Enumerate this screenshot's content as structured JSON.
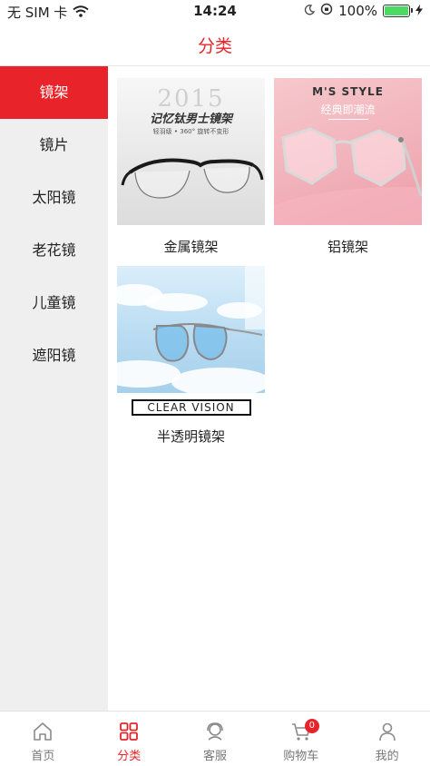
{
  "status_bar": {
    "carrier": "无 SIM 卡",
    "time": "14:24",
    "battery_percent": "100%",
    "battery_level": 1.0
  },
  "header": {
    "title": "分类"
  },
  "sidebar": {
    "items": [
      {
        "label": "镜架",
        "active": true
      },
      {
        "label": "镜片"
      },
      {
        "label": "太阳镜"
      },
      {
        "label": "老花镜"
      },
      {
        "label": "儿童镜"
      },
      {
        "label": "遮阳镜"
      }
    ]
  },
  "products": [
    {
      "label": "金属镜架",
      "image_text": {
        "year": "2015",
        "headline": "记忆钛男士镜架",
        "sub": "轻羽级 • 360° 旋转不变形"
      }
    },
    {
      "label": "铝镜架",
      "image_text": {
        "brand": "M'S STYLE",
        "slogan": "经典即潮流"
      }
    },
    {
      "label": "半透明镜架",
      "image_text": {
        "caption": "CLEAR VISION"
      }
    }
  ],
  "tabbar": {
    "items": [
      {
        "label": "首页",
        "icon": "home-icon"
      },
      {
        "label": "分类",
        "icon": "category-grid-icon",
        "active": true
      },
      {
        "label": "客服",
        "icon": "customer-service-icon"
      },
      {
        "label": "购物车",
        "icon": "cart-icon",
        "badge": "0"
      },
      {
        "label": "我的",
        "icon": "user-icon"
      }
    ]
  },
  "colors": {
    "accent": "#e8242a",
    "sidebar_bg": "#efefef",
    "battery": "#4cd964"
  }
}
